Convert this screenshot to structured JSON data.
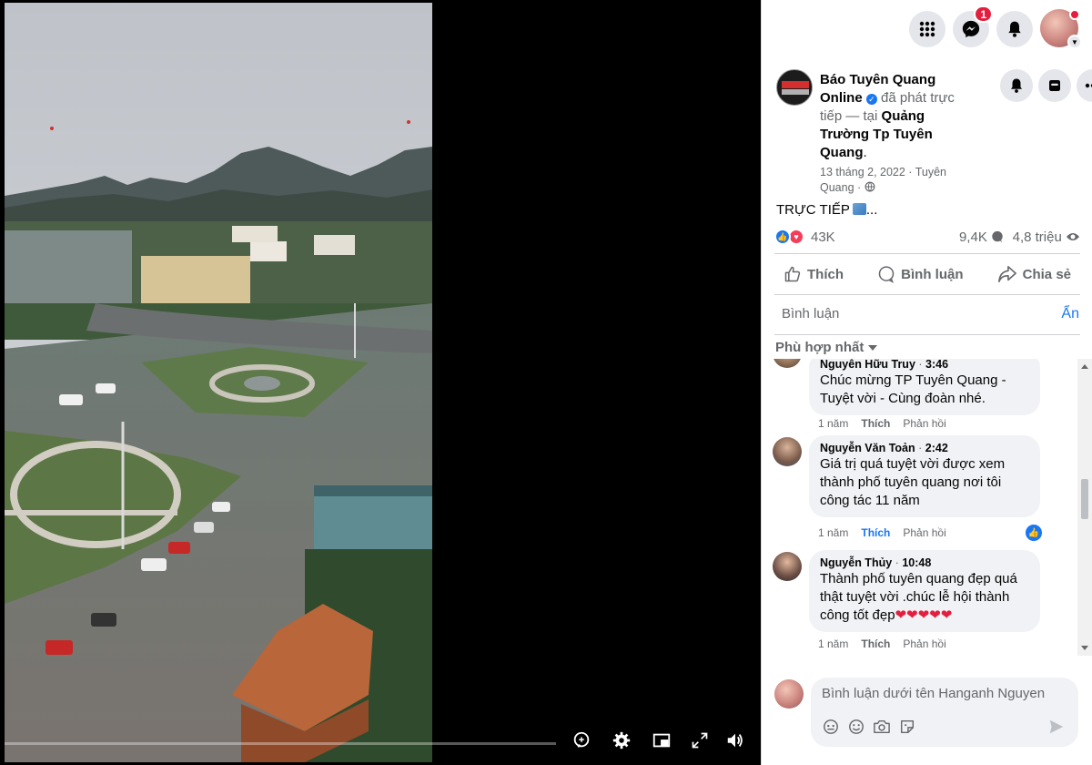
{
  "topbar": {
    "messenger_badge": "1",
    "icons": [
      "grid-menu-icon",
      "messenger-icon",
      "bell-icon"
    ]
  },
  "post": {
    "page_name": "Báo Tuyên Quang Online",
    "action_text": "đã phát trực tiếp — tại",
    "place": "Quảng Trường Tp Tuyên Quang",
    "date": "13 tháng 2, 2022 · Tuyên Quang ·",
    "live_text": "TRỰC TIẾP",
    "live_suffix": "...",
    "reaction_count": "43K",
    "comment_count": "9,4K",
    "view_count": "4,8 triệu"
  },
  "actions": {
    "like": "Thích",
    "comment": "Bình luận",
    "share": "Chia sẻ"
  },
  "comments_section": {
    "label": "Bình luận",
    "hide": "Ẩn",
    "sort": "Phù hợp nhất"
  },
  "comments": [
    {
      "author": "Nguyễn Hữu Truy",
      "time": "3:46",
      "text": "Chúc mừng TP Tuyên Quang - Tuyệt vời - Cùng đoàn nhé.",
      "age": "1 năm",
      "like": "Thích",
      "reply": "Phản hồi"
    },
    {
      "author": "Nguyễn Văn Toản",
      "time": "2:42",
      "text": "Giá trị quá tuyệt vời được xem thành phố tuyên quang nơi tôi công tác 11 năm",
      "age": "1 năm",
      "like": "Thích",
      "reply": "Phản hồi"
    },
    {
      "author": "Nguyễn Thủy",
      "time": "10:48",
      "text": "Thành phố tuyên quang đẹp quá thật tuyệt vời .chúc lễ hội thành công tốt đẹp",
      "age": "1 năm",
      "like": "Thích",
      "reply": "Phản hồi"
    }
  ],
  "composer": {
    "placeholder": "Bình luận dưới tên Hanganh Nguyen"
  },
  "colors": {
    "accent": "#1877f2",
    "text_secondary": "#65676b",
    "badge": "#e41e3f"
  }
}
